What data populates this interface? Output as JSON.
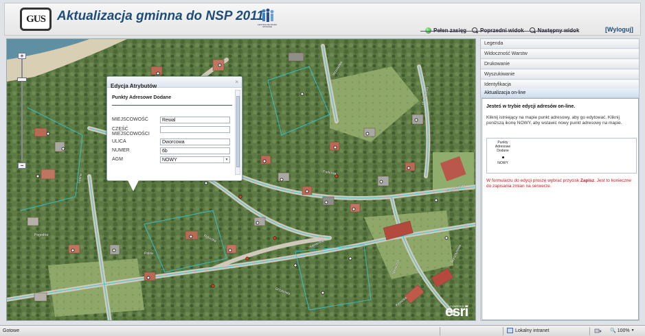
{
  "header": {
    "logo_text": "GUS",
    "title": "Aktualizacja gminna do NSP 2011",
    "partner_logo_caption": "CENTRALNE BIURO SPISOWE",
    "nav": [
      {
        "label": "Pełen zasięg",
        "icon": "globe-icon"
      },
      {
        "label": "Poprzedni widok",
        "icon": "magnifier-icon"
      },
      {
        "label": "Następny widok",
        "icon": "magnifier-icon"
      }
    ],
    "logout": "[Wyloguj]"
  },
  "map": {
    "streets": [
      "Wrzosowa",
      "Mickiewicza",
      "Parkowa",
      "Westerplatte",
      "Pogodna",
      "Rybacka",
      "Kamienna",
      "Słoneczna",
      "Klonowa",
      "Grzybowa",
      "Bursztynowa",
      "Leśna",
      "Polna"
    ],
    "powered_by": "POWERED BY",
    "vendor_logo": "esri"
  },
  "popup": {
    "title": "Edycja Atrybutów",
    "close": "×",
    "layer": "Punkty Adresowe Dodane",
    "fields": [
      {
        "label": "MIEJSCOWOŚĆ",
        "value": "Rewal"
      },
      {
        "label": "CZĘŚĆ MIEJSCOWOŚCI",
        "value": ""
      },
      {
        "label": "ULICA",
        "value": "Dworcowa"
      },
      {
        "label": "NUMER",
        "value": "6b"
      },
      {
        "label": "AGM",
        "value": "NOWY",
        "select": true
      }
    ]
  },
  "panel": {
    "sections": [
      "Legenda",
      "Widoczność Warstw",
      "Drukowanie",
      "Wyszukiwanie",
      "Identyfikacja",
      "Aktualizacja on-line"
    ],
    "active_section": "Aktualizacja on-line",
    "heading": "Jesteś w trybie edycji adresów on-line.",
    "instructions": "Kliknij istniejący na mapie punkt adresowy, aby go edytować. Kliknij poniższą ikonę NOWY, aby wstawić nowy punkt adresowy na mapie.",
    "template": {
      "label": "Punkty Adresowe Dodane",
      "caption": "NOWY"
    },
    "note_prefix": "W formularzu do edycji proszę wybrać przycisk ",
    "note_bold": "Zapisz",
    "note_suffix": ". Jest to konieczne do zapisania zmian na serwerze."
  },
  "statusbar": {
    "left": "Gotowe",
    "zone": "Lokalny intranet",
    "zoom": "100%"
  }
}
